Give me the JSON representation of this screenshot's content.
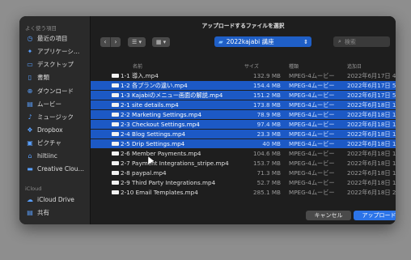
{
  "dialog_title": "アップロードするファイルを選択",
  "sidebar": {
    "recents_header": "よく使う項目",
    "items": [
      {
        "icon": "clock-icon",
        "label": "最近の項目"
      },
      {
        "icon": "app-icon",
        "label": "アプリケーシ…"
      },
      {
        "icon": "desktop-icon",
        "label": "デスクトップ"
      },
      {
        "icon": "document-icon",
        "label": "書類"
      },
      {
        "icon": "download-icon",
        "label": "ダウンロード"
      },
      {
        "icon": "film-icon",
        "label": "ムービー"
      },
      {
        "icon": "music-icon",
        "label": "ミュージック"
      },
      {
        "icon": "dropbox-icon",
        "label": "Dropbox"
      },
      {
        "icon": "photo-icon",
        "label": "ピクチャ"
      },
      {
        "icon": "home-icon",
        "label": "hiltiinc"
      },
      {
        "icon": "folder-icon",
        "label": "Creative Clou…"
      }
    ],
    "icloud_header": "iCloud",
    "icloud_items": [
      {
        "icon": "cloud-icon",
        "label": "iCloud Drive"
      },
      {
        "icon": "shared-icon",
        "label": "共有"
      }
    ]
  },
  "toolbar": {
    "back": "‹",
    "forward": "›",
    "list_view": "☰ ▾",
    "grid_view": "▦ ▾",
    "folder": "2022kajabi 講座",
    "search_placeholder": "検索"
  },
  "columns": {
    "name": "名前",
    "size": "サイズ",
    "kind": "種類",
    "date": "追加日"
  },
  "files": [
    {
      "name": "1-1 導入.mp4",
      "size": "132.9 MB",
      "kind": "MPEG-4ムービー",
      "date": "2022年6月17日 4",
      "selected": false
    },
    {
      "name": "1-2 各プランの違い.mp4",
      "size": "154.4 MB",
      "kind": "MPEG-4ムービー",
      "date": "2022年6月17日 5",
      "selected": true
    },
    {
      "name": "1-3 Kajabiのメニュー画面の解説.mp4",
      "size": "151.2 MB",
      "kind": "MPEG-4ムービー",
      "date": "2022年6月17日 5",
      "selected": true
    },
    {
      "name": "2-1 site details.mp4",
      "size": "173.8 MB",
      "kind": "MPEG-4ムービー",
      "date": "2022年6月18日 1",
      "selected": true
    },
    {
      "name": "2-2 Marketing Settings.mp4",
      "size": "78.9 MB",
      "kind": "MPEG-4ムービー",
      "date": "2022年6月18日 1",
      "selected": true
    },
    {
      "name": "2-3 Checkout Settings.mp4",
      "size": "97.4 MB",
      "kind": "MPEG-4ムービー",
      "date": "2022年6月18日 1",
      "selected": true
    },
    {
      "name": "2-4 Blog Settings.mp4",
      "size": "23.3 MB",
      "kind": "MPEG-4ムービー",
      "date": "2022年6月18日 1",
      "selected": true
    },
    {
      "name": "2-5 Drip Settings.mp4",
      "size": "40 MB",
      "kind": "MPEG-4ムービー",
      "date": "2022年6月18日 1",
      "selected": true
    },
    {
      "name": "2-6 Member Payments.mp4",
      "size": "104.6 MB",
      "kind": "MPEG-4ムービー",
      "date": "2022年6月18日 1",
      "selected": false
    },
    {
      "name": "2-7 Payment Integrations_stripe.mp4",
      "size": "153.7 MB",
      "kind": "MPEG-4ムービー",
      "date": "2022年6月18日 1",
      "selected": false
    },
    {
      "name": "2-8 paypal.mp4",
      "size": "71.3 MB",
      "kind": "MPEG-4ムービー",
      "date": "2022年6月18日 1",
      "selected": false
    },
    {
      "name": "2-9 Third Party Integrations.mp4",
      "size": "52.7 MB",
      "kind": "MPEG-4ムービー",
      "date": "2022年6月18日 1",
      "selected": false
    },
    {
      "name": "2-10 Email Templates.mp4",
      "size": "285.1 MB",
      "kind": "MPEG-4ムービー",
      "date": "2022年6月18日 2",
      "selected": false
    }
  ],
  "buttons": {
    "cancel": "キャンセル",
    "upload": "アップロード"
  },
  "colors": {
    "selection": "#1c59c5",
    "primary_button": "#2c74e8",
    "folder_popup": "#1f5fc7"
  }
}
